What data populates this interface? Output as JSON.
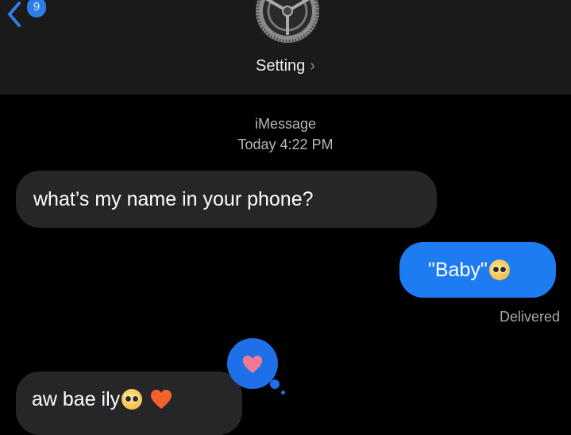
{
  "header": {
    "back_badge": "9",
    "contact_name": "Setting",
    "chevron": "›"
  },
  "thread": {
    "service": "iMessage",
    "timestamp": "Today 4:22 PM"
  },
  "messages": [
    {
      "from": "them",
      "text": "what’s my name in your phone?"
    },
    {
      "from": "me",
      "text": "\"Baby\"",
      "emoji": "pleading-face"
    },
    {
      "from": "them",
      "text": "aw bae ily",
      "emoji": [
        "pleading-face",
        "orange-heart"
      ],
      "tapback": "heart"
    }
  ],
  "status": "Delivered",
  "colors": {
    "blue": "#1e7cf2",
    "gray": "#262628",
    "header": "#1a1a1a"
  }
}
